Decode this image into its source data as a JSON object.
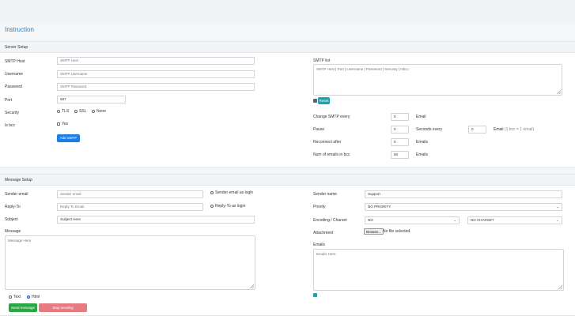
{
  "page": {
    "title": "Instruction"
  },
  "server": {
    "header": "Server Setup",
    "smtp_host": {
      "label": "SMTP Host",
      "placeholder": "SMTP Host"
    },
    "username": {
      "label": "Username",
      "placeholder": "SMTP Username"
    },
    "password": {
      "label": "Password",
      "placeholder": "SMTP Password"
    },
    "port": {
      "label": "Port",
      "value": "587"
    },
    "security": {
      "label": "Security",
      "options": [
        "TLS",
        "SSL",
        "None"
      ]
    },
    "isbcc": {
      "label": "Is bcc",
      "option": "Yes"
    },
    "add_button": "Add SMTP",
    "smtp_list": {
      "label": "SMTP list",
      "placeholder": "SMTP Host | Port | Username | Password | Security | Isbcc"
    },
    "reset_button": "Reset",
    "change_every": {
      "label": "Change SMTP every",
      "value": "0",
      "unit": "Email"
    },
    "pause": {
      "label": "Pause",
      "value": "0",
      "unit": "Seconds every",
      "value2": "0",
      "unit2": "Email",
      "note": "(1 bcc = 1 email)"
    },
    "reconnect": {
      "label": "Reconnect after",
      "value": "0",
      "unit": "Emails"
    },
    "num_bcc": {
      "label": "Num of emails in bcc",
      "value": "50",
      "unit": "Emails"
    }
  },
  "message": {
    "header": "Message Setup",
    "sender_email": {
      "label": "Sender email",
      "placeholder": "Sender email",
      "login_option": "Sender email as login"
    },
    "reply_to": {
      "label": "Reply-To",
      "placeholder": "Reply-To Email",
      "login_option": "Reply-To as login"
    },
    "subject": {
      "label": "Subject",
      "placeholder": "Subject Here"
    },
    "body": {
      "label": "Message",
      "placeholder": "Message Here"
    },
    "format": {
      "options": [
        "Text",
        "Html"
      ],
      "selected": "Html"
    },
    "send_button": "Send message",
    "stop_button": "Stop sending",
    "sender_name": {
      "label": "Sender name",
      "value": "Support"
    },
    "priority": {
      "label": "Priority",
      "value": "NO PRIORITY"
    },
    "encoding": {
      "label": "Encoding / Charset",
      "value": "NO",
      "charset": "NO CHARSET"
    },
    "attachment": {
      "label": "Attachment",
      "button": "Browse...",
      "status": "No file selected."
    },
    "emails": {
      "label": "Emails",
      "placeholder": "Emails Here"
    }
  }
}
